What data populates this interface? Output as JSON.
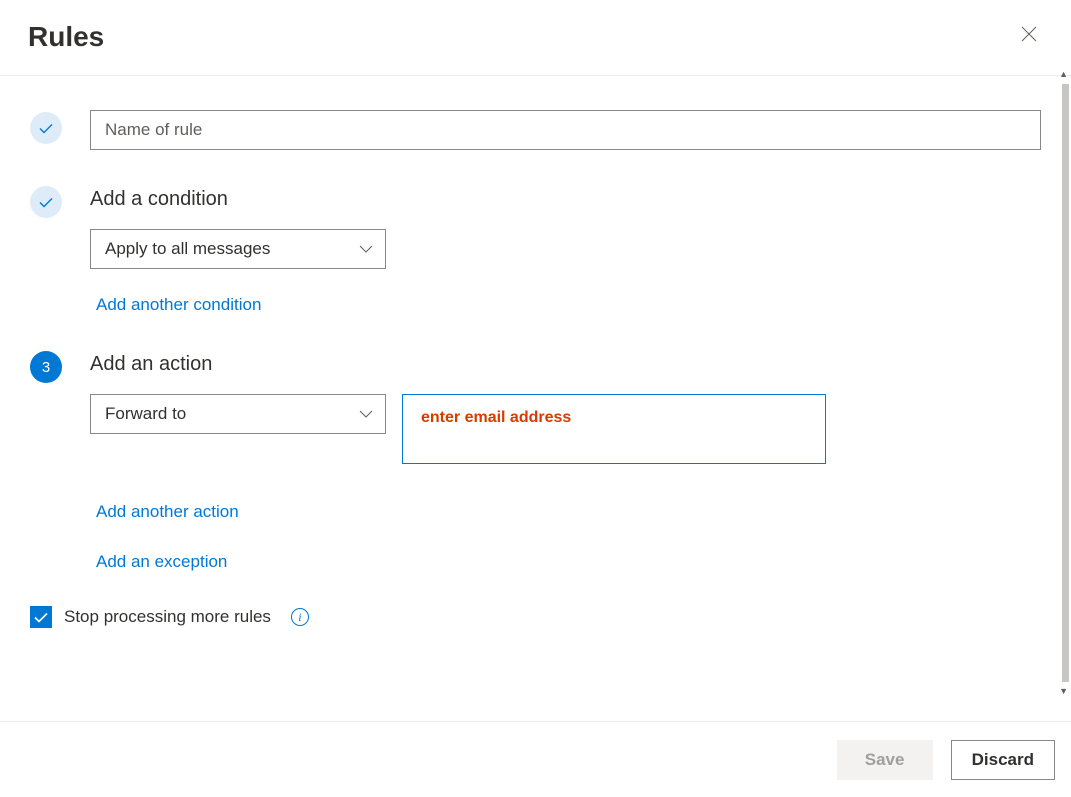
{
  "header": {
    "title": "Rules"
  },
  "step1": {
    "placeholder": "Name of rule",
    "value": ""
  },
  "step2": {
    "title": "Add a condition",
    "dropdown_value": "Apply to all messages",
    "add_link": "Add another condition"
  },
  "step3": {
    "badge": "3",
    "title": "Add an action",
    "dropdown_value": "Forward to",
    "email_annotation": "enter email address",
    "add_action_link": "Add another action",
    "add_exception_link": "Add an exception"
  },
  "stop_processing": {
    "label": "Stop processing more rules",
    "checked": true
  },
  "footer": {
    "save": "Save",
    "discard": "Discard"
  }
}
